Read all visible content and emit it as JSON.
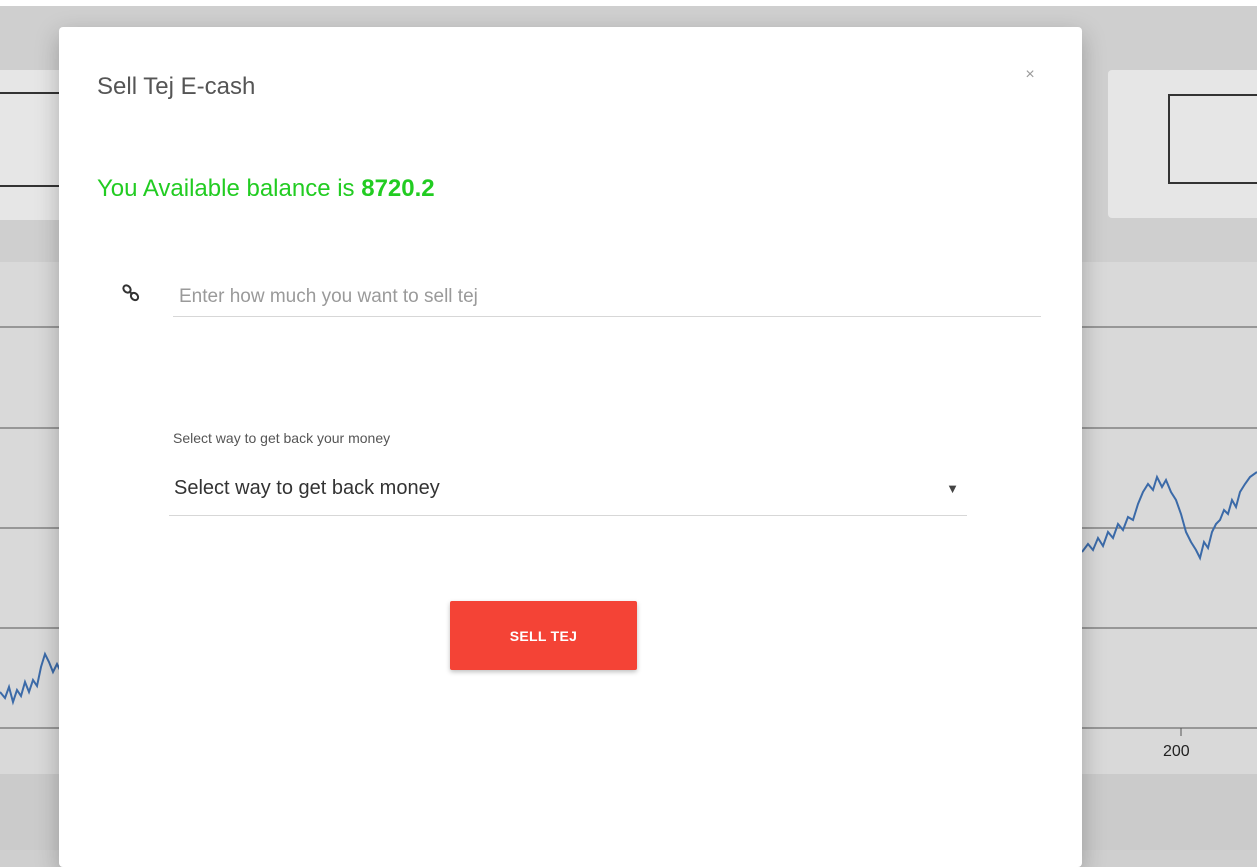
{
  "modal": {
    "title": "Sell Tej E-cash",
    "close_symbol": "×",
    "balance_prefix": "You Available balance is",
    "balance_value": "8720.2",
    "amount_placeholder": "Enter how much you want to sell tej",
    "amount_value": "",
    "select_label": "Select way to get back your money",
    "select_value": "Select way to get back money",
    "sell_button_label": "SELL TEJ",
    "icons": {
      "amount_field_icon": "link-icon",
      "close_icon": "close-icon",
      "select_caret_icon": "caret-down-icon"
    },
    "colors": {
      "balance_text": "#22cc22",
      "sell_button": "#f44336"
    }
  },
  "background": {
    "chart_tick_label": "200"
  }
}
